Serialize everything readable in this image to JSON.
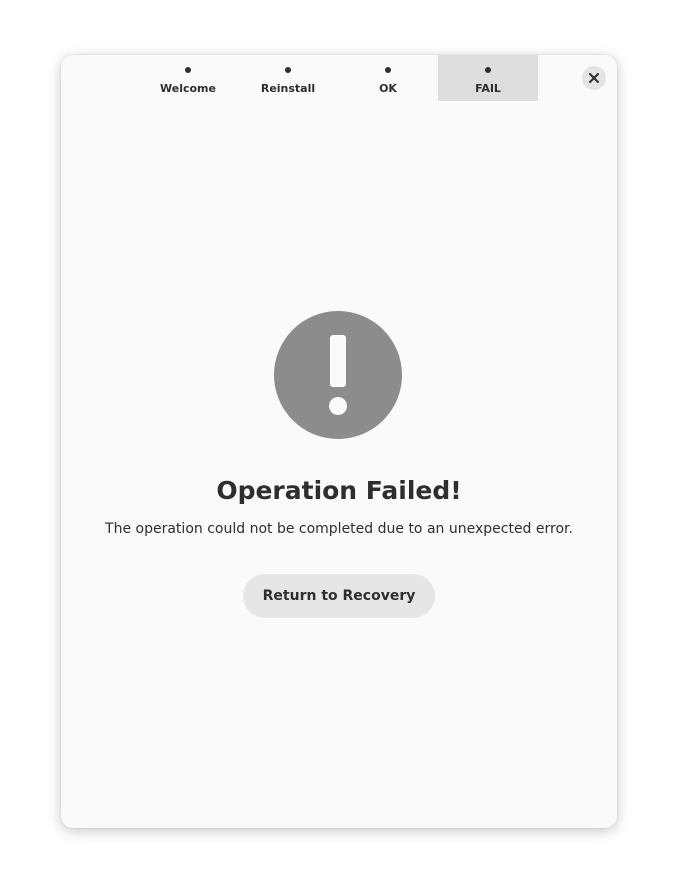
{
  "steps": [
    {
      "label": "Welcome"
    },
    {
      "label": "Reinstall"
    },
    {
      "label": "OK"
    },
    {
      "label": "FAIL"
    }
  ],
  "active_step": "FAIL",
  "close_icon": "close-icon",
  "status_icon": "exclamation-icon",
  "title": "Operation Failed!",
  "description": "The operation could not be completed due to an unexpected error.",
  "action_label": "Return to Recovery",
  "colors": {
    "icon_circle": "#8c8c8c",
    "active_step_bg": "#dedede",
    "button_bg": "#e6e6e6",
    "text": "#2e2e2e"
  }
}
